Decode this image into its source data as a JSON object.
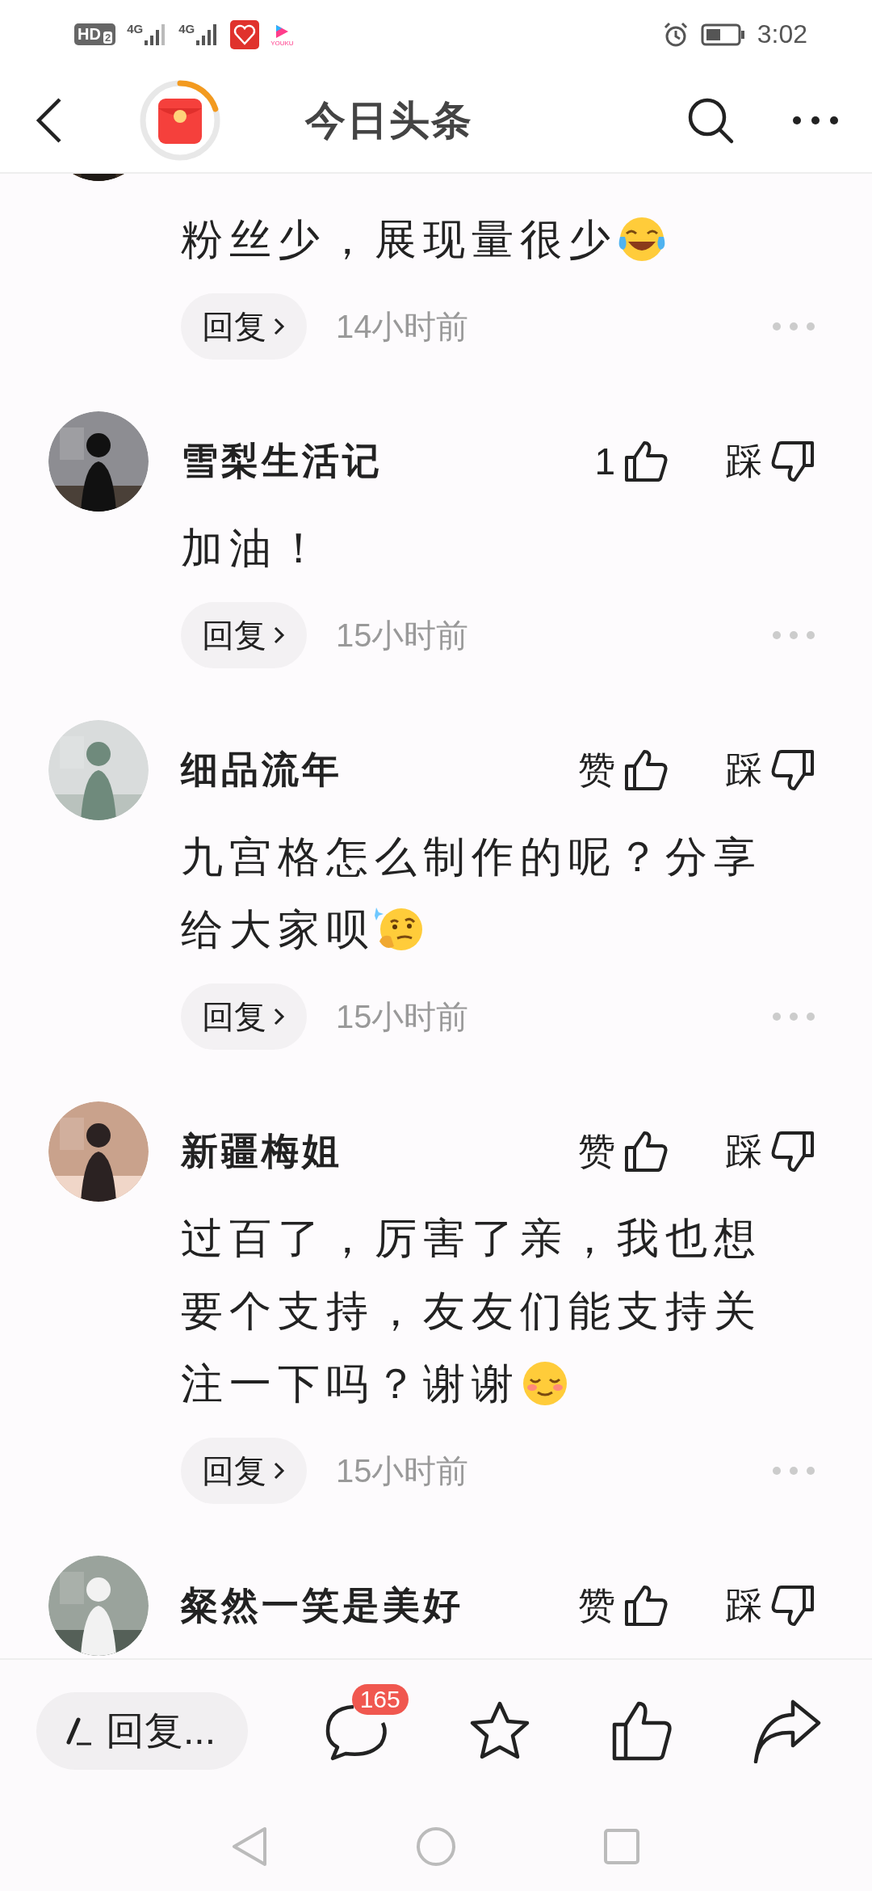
{
  "status_bar": {
    "hd": "HD",
    "hd_sim": "2",
    "signals": [
      "4G",
      "4G"
    ],
    "app_label": "YOUKU",
    "time": "3:02"
  },
  "header": {
    "title": "今日头条",
    "reward_ring": {
      "level": 0.2
    }
  },
  "comments": [
    {
      "text_lines": [
        "粉丝少，展现量很少"
      ],
      "emoji": {
        "kind": "tears-of-joy"
      },
      "reply_label": "回复",
      "time": "14小时前"
    },
    {
      "author": "雪梨生活记",
      "likes": "1",
      "dislike_label": "踩",
      "text_lines": [
        "加油！"
      ],
      "reply_label": "回复",
      "time": "15小时前"
    },
    {
      "author": "细品流年",
      "likes": "赞",
      "dislike_label": "踩",
      "text_lines": [
        "九宫格怎么制作的呢？分享",
        "给大家呗"
      ],
      "emoji": {
        "kind": "thinking"
      },
      "reply_label": "回复",
      "time": "15小时前"
    },
    {
      "author": "新疆梅姐",
      "likes": "赞",
      "dislike_label": "踩",
      "text_lines": [
        "过百了，厉害了亲，我也想",
        "要个支持，友友们能支持关",
        "注一下吗？谢谢"
      ],
      "emoji": {
        "kind": "smiling"
      },
      "reply_label": "回复",
      "time": "15小时前"
    },
    {
      "author": "粲然一笑是美好",
      "likes": "赞",
      "dislike_label": "踩"
    }
  ],
  "bottom_bar": {
    "reply_placeholder": "回复...",
    "comment_count": "165"
  }
}
